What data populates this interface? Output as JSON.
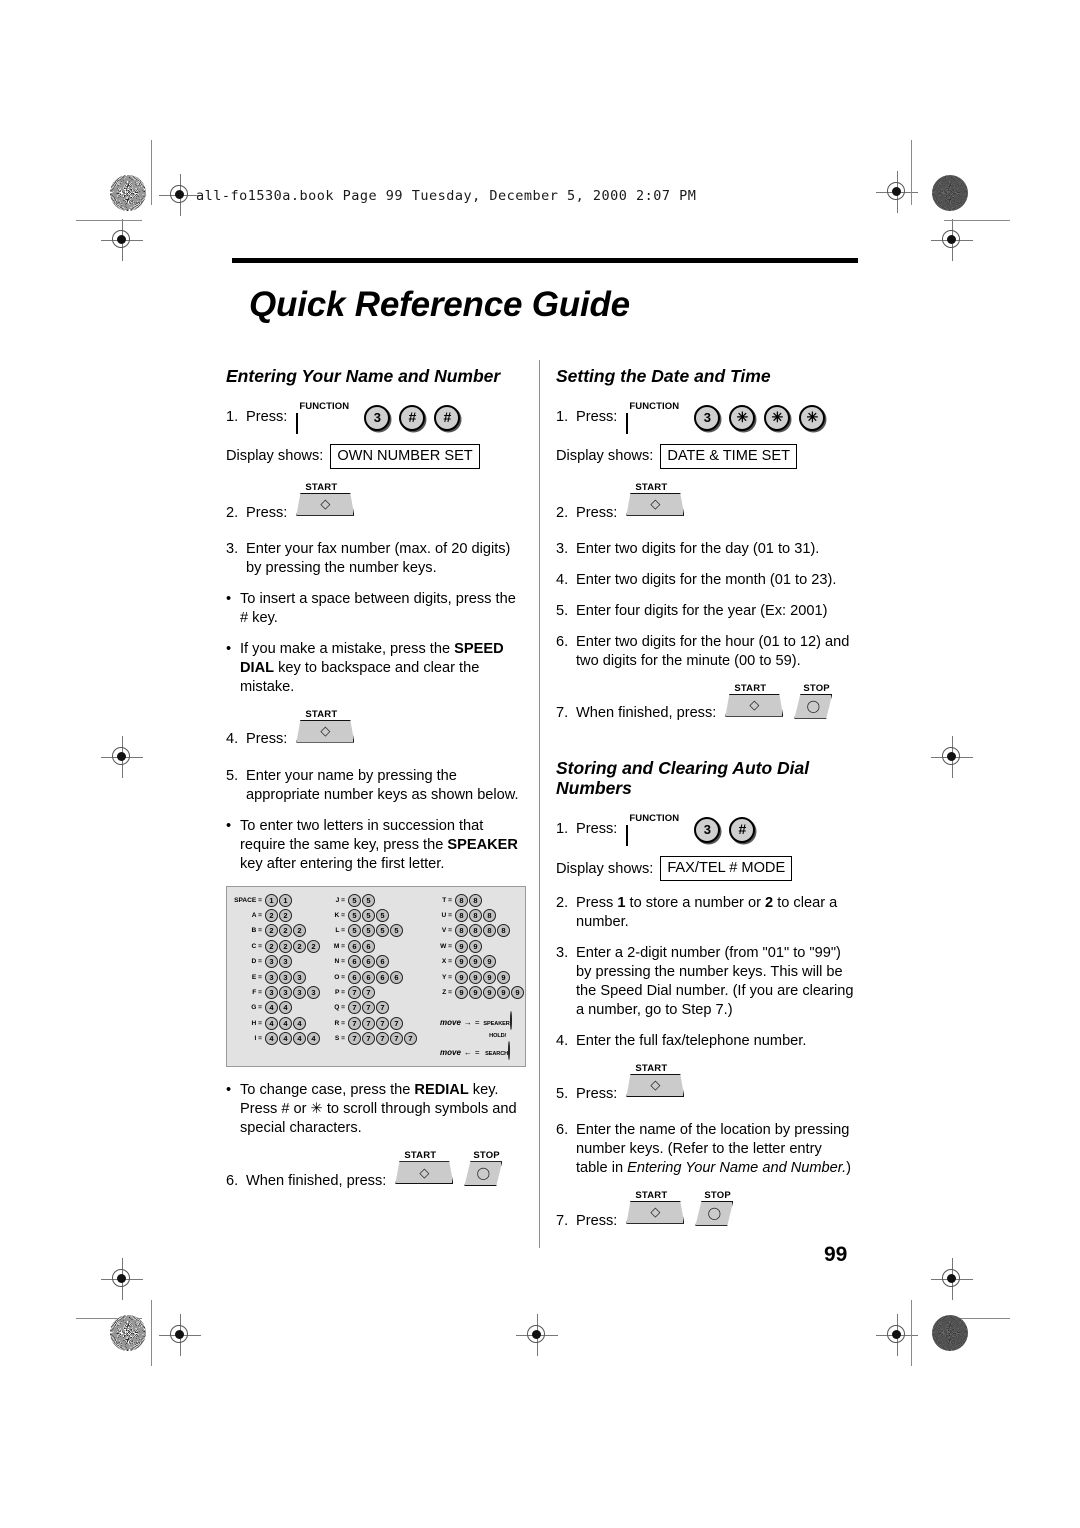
{
  "file_strip": "all-fo1530a.book  Page 99  Tuesday, December 5, 2000  2:07 PM",
  "doc_title": "Quick Reference Guide",
  "page_number": "99",
  "keys": {
    "function": "FUNCTION",
    "start": "START",
    "stop": "STOP",
    "three": "3",
    "hash": "#",
    "star": "✳",
    "speaker": "SPEAKER",
    "hold_search_line1": "HOLD/",
    "hold_search_line2": "SEARCH"
  },
  "labels": {
    "display_shows": "Display shows:",
    "press": "Press:",
    "when_finished_press": "When finished, press:"
  },
  "left_column": {
    "section1": {
      "heading": "Entering Your Name and Number",
      "step1_num": "1.",
      "step1_label": "Press:",
      "display1": "OWN NUMBER SET",
      "step2_num": "2.",
      "step2_label": "Press:",
      "step3_num": "3.",
      "step3_text": "Enter your fax number (max. of 20 digits) by pressing the number keys.",
      "bullet1_text_a": "To insert  a space between digits, press the # key.",
      "bullet2_pre": "If you make a mistake, press the ",
      "bullet2_bold": "SPEED DIAL",
      "bullet2_post": " key to backspace and clear the mistake.",
      "step4_num": "4.",
      "step4_label": "Press:",
      "step5_num": "5.",
      "step5_text": "Enter your name by pressing the appropriate number keys as shown below.",
      "bullet3_pre": "To enter two letters in succession that require the same key, press the ",
      "bullet3_bold": "SPEAKER",
      "bullet3_post": " key after entering the first letter.",
      "bullet4_pre": "To change case, press the ",
      "bullet4_bold": "REDIAL",
      "bullet4_post": " key. Press # or ✳ to scroll through symbols and special characters.",
      "step6_num": "6.",
      "step6_label": "When finished, press:"
    },
    "letter_table": {
      "column1": [
        {
          "label": "SPACE =",
          "digits": [
            "1",
            "1"
          ]
        },
        {
          "label": "A =",
          "digits": [
            "2",
            "2"
          ]
        },
        {
          "label": "B =",
          "digits": [
            "2",
            "2",
            "2"
          ]
        },
        {
          "label": "C =",
          "digits": [
            "2",
            "2",
            "2",
            "2"
          ]
        },
        {
          "label": "D =",
          "digits": [
            "3",
            "3"
          ]
        },
        {
          "label": "E =",
          "digits": [
            "3",
            "3",
            "3"
          ]
        },
        {
          "label": "F =",
          "digits": [
            "3",
            "3",
            "3",
            "3"
          ]
        },
        {
          "label": "G =",
          "digits": [
            "4",
            "4"
          ]
        },
        {
          "label": "H =",
          "digits": [
            "4",
            "4",
            "4"
          ]
        },
        {
          "label": "I =",
          "digits": [
            "4",
            "4",
            "4",
            "4"
          ]
        }
      ],
      "column2": [
        {
          "label": "J =",
          "digits": [
            "5",
            "5"
          ]
        },
        {
          "label": "K =",
          "digits": [
            "5",
            "5",
            "5"
          ]
        },
        {
          "label": "L =",
          "digits": [
            "5",
            "5",
            "5",
            "5"
          ]
        },
        {
          "label": "M =",
          "digits": [
            "6",
            "6"
          ]
        },
        {
          "label": "N =",
          "digits": [
            "6",
            "6",
            "6"
          ]
        },
        {
          "label": "O =",
          "digits": [
            "6",
            "6",
            "6",
            "6"
          ]
        },
        {
          "label": "P =",
          "digits": [
            "7",
            "7"
          ]
        },
        {
          "label": "Q =",
          "digits": [
            "7",
            "7",
            "7"
          ]
        },
        {
          "label": "R =",
          "digits": [
            "7",
            "7",
            "7",
            "7"
          ]
        },
        {
          "label": "S =",
          "digits": [
            "7",
            "7",
            "7",
            "7",
            "7"
          ]
        }
      ],
      "column3": [
        {
          "label": "T =",
          "digits": [
            "8",
            "8"
          ]
        },
        {
          "label": "U =",
          "digits": [
            "8",
            "8",
            "8"
          ]
        },
        {
          "label": "V =",
          "digits": [
            "8",
            "8",
            "8",
            "8"
          ]
        },
        {
          "label": "W =",
          "digits": [
            "9",
            "9"
          ]
        },
        {
          "label": "X =",
          "digits": [
            "9",
            "9",
            "9"
          ]
        },
        {
          "label": "Y =",
          "digits": [
            "9",
            "9",
            "9",
            "9"
          ]
        },
        {
          "label": "Z =",
          "digits": [
            "9",
            "9",
            "9",
            "9",
            "9"
          ]
        }
      ],
      "move_right_label": "move",
      "move_right_arrow": "→",
      "move_right_eq": "=",
      "move_left_label": "move",
      "move_left_arrow": "←",
      "move_left_eq": "="
    }
  },
  "right_column": {
    "section2": {
      "heading": "Setting the Date and Time",
      "step1_num": "1.",
      "step1_label": "Press:",
      "display1": "DATE & TIME SET",
      "step2_num": "2.",
      "step2_label": "Press:",
      "step3_num": "3.",
      "step3_text": "Enter two digits for the day (01 to 31).",
      "step4_num": "4.",
      "step4_text": "Enter two digits for the month (01 to 23).",
      "step5_num": "5.",
      "step5_text": "Enter four digits for the year (Ex: 2001)",
      "step6_num": "6.",
      "step6_text": "Enter two digits for the hour (01 to 12) and two digits for the minute (00 to 59).",
      "step7_num": "7.",
      "step7_label": "When finished, press:"
    },
    "section3": {
      "heading": "Storing and Clearing Auto Dial Numbers",
      "step1_num": "1.",
      "step1_label": "Press:",
      "display1": "FAX/TEL # MODE",
      "step2_num": "2.",
      "step2_pre": "Press ",
      "step2_bold1": "1",
      "step2_mid": " to store a number or ",
      "step2_bold2": "2",
      "step2_post": " to clear a number.",
      "step3_num": "3.",
      "step3_text": "Enter a 2-digit number (from \"01\" to \"99\") by pressing the number keys. This will be the Speed Dial number. (If you are clearing a number, go to Step 7.)",
      "step4_num": "4.",
      "step4_text": "Enter the full fax/telephone number.",
      "step5_num": "5.",
      "step5_label": "Press:",
      "step6_num": "6.",
      "step6_pre": "Enter the name of the location by pressing number keys. (Refer to the letter entry table in ",
      "step6_italic": "Entering Your Name and Number.",
      "step6_post": ")",
      "step7_num": "7.",
      "step7_label": "Press:"
    }
  }
}
